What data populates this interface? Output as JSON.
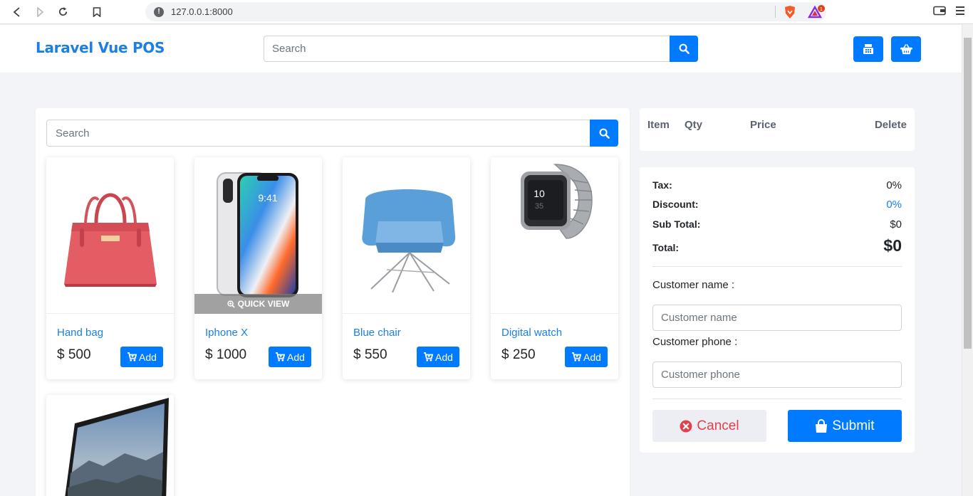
{
  "browser": {
    "url": "127.0.0.1:8000",
    "notification_count": "1"
  },
  "navbar": {
    "brand": "Laravel Vue POS",
    "search_placeholder": "Search"
  },
  "products_panel": {
    "search_placeholder": "Search",
    "quick_view_label": "QUICK VIEW",
    "add_label": "Add",
    "items": [
      {
        "name": "Hand bag",
        "price": "$ 500"
      },
      {
        "name": "Iphone X",
        "price": "$ 1000"
      },
      {
        "name": "Blue chair",
        "price": "$ 550"
      },
      {
        "name": "Digital watch",
        "price": "$ 250"
      }
    ]
  },
  "cart": {
    "columns": {
      "item": "Item",
      "qty": "Qty",
      "price": "Price",
      "delete": "Delete"
    }
  },
  "summary": {
    "tax_label": "Tax:",
    "tax_value": "0%",
    "discount_label": "Discount:",
    "discount_value": "0%",
    "subtotal_label": "Sub Total:",
    "subtotal_value": "$0",
    "total_label": "Total:",
    "total_value": "$0",
    "customer_name_label": "Customer name :",
    "customer_name_placeholder": "Customer name",
    "customer_phone_label": "Customer phone :",
    "customer_phone_placeholder": "Customer phone",
    "cancel_label": "Cancel",
    "submit_label": "Submit"
  },
  "colors": {
    "primary": "#007bff",
    "brand_text": "#1b7fe5",
    "cancel_text": "#e3414a",
    "page_bg": "#f3f4f8"
  }
}
